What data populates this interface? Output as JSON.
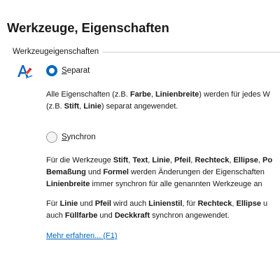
{
  "page": {
    "title": "Werkzeuge, Eigenschaften"
  },
  "group": {
    "title": "Werkzeugeigenschaften",
    "icon": "text-pen-icon",
    "accent_color": "#0067c0"
  },
  "options": {
    "separat": {
      "label": "Separat",
      "checked": true
    },
    "synchron": {
      "label": "Synchron",
      "checked": false
    }
  },
  "descriptions": {
    "separat": {
      "line1": [
        "Alle Eigenschaften (z.B. ",
        "Farbe",
        ", ",
        "Linienbreite",
        ") werden für jedes W"
      ],
      "line2": [
        "(z.B. ",
        "Stift",
        ", ",
        "Linie",
        ") separat angewendet."
      ]
    },
    "synchron_1": {
      "line1": [
        "Für die Werkzeuge ",
        "Stift",
        ", ",
        "Text",
        ", ",
        "Linie",
        ", ",
        "Pfeil",
        ", ",
        "Rechteck",
        ", ",
        "Ellipse",
        ", ",
        "Po"
      ],
      "line2": [
        "Bemaßung",
        " und ",
        "Formel",
        " werden Änderungen der Eigenschaften"
      ],
      "line3": [
        "Linienbreite",
        " immer synchron für alle genannten Werkzeuge an"
      ]
    },
    "synchron_2": {
      "line1": [
        "Für ",
        "Linie",
        " und ",
        "Pfeil",
        " wird auch ",
        "Linienstil",
        ", für ",
        "Rechteck",
        ", ",
        "Ellipse",
        " u"
      ],
      "line2": [
        "auch ",
        "Füllfarbe",
        " und ",
        "Deckkraft",
        " synchron angewendet."
      ]
    }
  },
  "help_link": {
    "label": "Mehr erfahren... (F1)"
  }
}
